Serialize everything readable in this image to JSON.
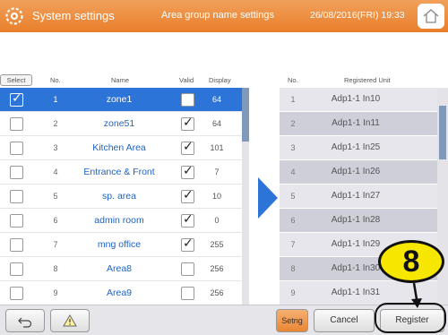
{
  "header": {
    "title": "System settings",
    "subtitle": "Area group name settings",
    "datetime": "26/08/2016(FRI) 19:33"
  },
  "left_table": {
    "headers": {
      "select": "Select",
      "no": "No.",
      "name": "Name",
      "valid": "Valid",
      "display": "Display"
    },
    "rows": [
      {
        "selected": true,
        "no": "1",
        "name": "zone1",
        "valid": true,
        "display": "64"
      },
      {
        "selected": false,
        "no": "2",
        "name": "zone51",
        "valid": true,
        "display": "64"
      },
      {
        "selected": false,
        "no": "3",
        "name": "Kitchen Area",
        "valid": true,
        "display": "101"
      },
      {
        "selected": false,
        "no": "4",
        "name": "Entrance & Front",
        "valid": true,
        "display": "7"
      },
      {
        "selected": false,
        "no": "5",
        "name": "sp. area",
        "valid": true,
        "display": "10"
      },
      {
        "selected": false,
        "no": "6",
        "name": "admin room",
        "valid": true,
        "display": "0"
      },
      {
        "selected": false,
        "no": "7",
        "name": "mng office",
        "valid": true,
        "display": "255"
      },
      {
        "selected": false,
        "no": "8",
        "name": "Area8",
        "valid": false,
        "display": "256"
      },
      {
        "selected": false,
        "no": "9",
        "name": "Area9",
        "valid": false,
        "display": "256"
      }
    ]
  },
  "right_table": {
    "headers": {
      "no": "No.",
      "unit": "Registered Unit"
    },
    "rows": [
      {
        "no": "1",
        "unit": "Adp1-1 In10"
      },
      {
        "no": "2",
        "unit": "Adp1-1 In11"
      },
      {
        "no": "3",
        "unit": "Adp1-1 In25"
      },
      {
        "no": "4",
        "unit": "Adp1-1 In26"
      },
      {
        "no": "5",
        "unit": "Adp1-1 In27"
      },
      {
        "no": "6",
        "unit": "Adp1-1 In28"
      },
      {
        "no": "7",
        "unit": "Adp1-1 In29"
      },
      {
        "no": "8",
        "unit": "Adp1-1 In30"
      },
      {
        "no": "9",
        "unit": "Adp1-1 In31"
      }
    ]
  },
  "footer": {
    "setng_label": "Setng",
    "cancel_label": "Cancel",
    "register_label": "Register"
  },
  "callout": {
    "number": "8"
  },
  "colors": {
    "accent": "#e97f2b",
    "selection": "#2c74d8",
    "link_text": "#1e63c5",
    "callout": "#f7e600"
  },
  "icons": {
    "header_left": "gear-icon",
    "header_right": "home-icon",
    "footer_back": "back-arrow-icon",
    "footer_warning": "warning-icon"
  }
}
